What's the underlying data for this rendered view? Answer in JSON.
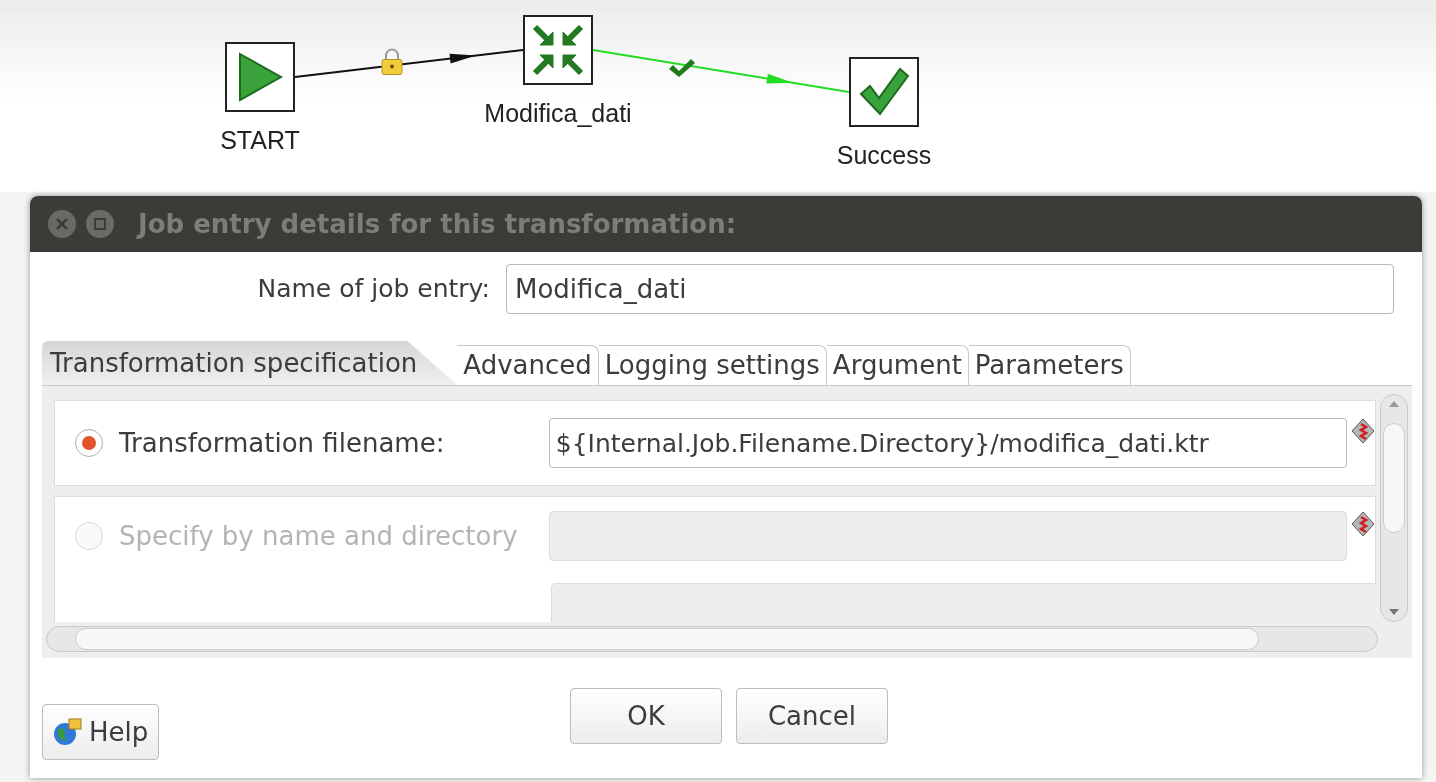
{
  "canvas": {
    "nodes": [
      {
        "label": "START",
        "kind": "start"
      },
      {
        "label": "Modifica_dati",
        "kind": "transformation"
      },
      {
        "label": "Success",
        "kind": "success"
      }
    ],
    "hops": [
      {
        "kind": "unconditional"
      },
      {
        "kind": "success"
      }
    ]
  },
  "dialog": {
    "title": "Job entry details for this transformation:",
    "name_field": {
      "label": "Name of job entry:",
      "value": "Modifica_dati"
    },
    "tabs": [
      {
        "label": "Transformation specification",
        "selected": true
      },
      {
        "label": "Advanced",
        "selected": false
      },
      {
        "label": "Logging settings",
        "selected": false
      },
      {
        "label": "Argument",
        "selected": false
      },
      {
        "label": "Parameters",
        "selected": false
      }
    ],
    "options": [
      {
        "kind": "filename",
        "label": "Transformation filename:",
        "selected": true,
        "disabled": false,
        "value": "${Internal.Job.Filename.Directory}/modifica_dati.ktr"
      },
      {
        "kind": "name_directory",
        "label": "Specify by name and directory",
        "selected": false,
        "disabled": true
      }
    ],
    "buttons": {
      "help": "Help",
      "ok": "OK",
      "cancel": "Cancel"
    }
  }
}
